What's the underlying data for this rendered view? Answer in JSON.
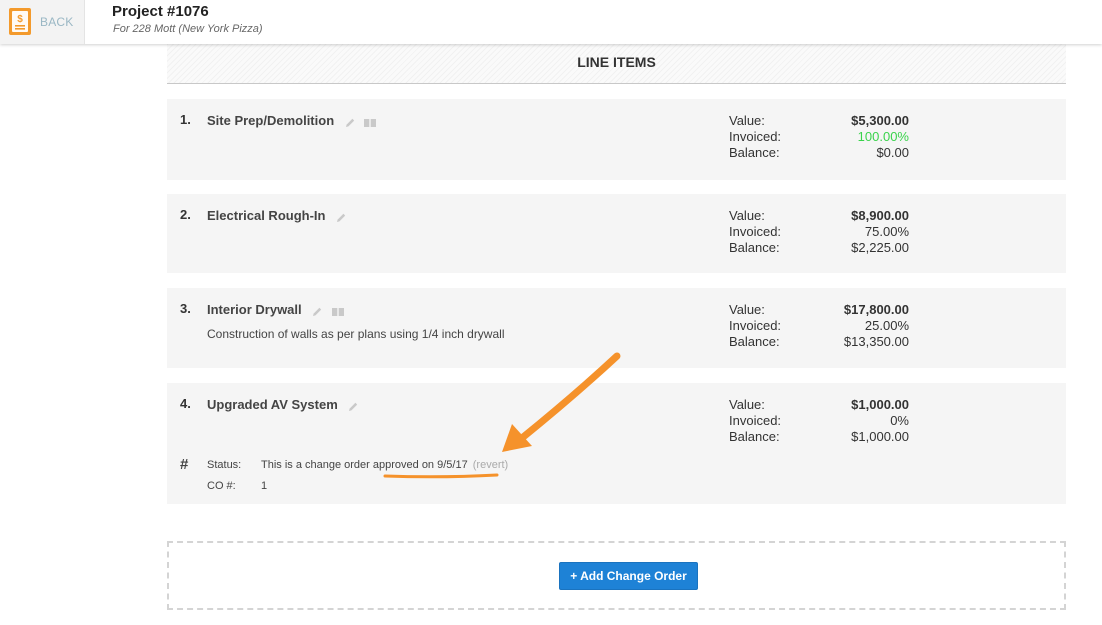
{
  "header": {
    "back_label": "BACK",
    "title": "Project #1076",
    "subtitle": "For 228 Mott (New York Pizza)"
  },
  "section": {
    "title": "LINE ITEMS"
  },
  "labels": {
    "value": "Value:",
    "invoiced": "Invoiced:",
    "balance": "Balance:",
    "status": "Status:",
    "co_num": "CO #:"
  },
  "items": [
    {
      "num": "1.",
      "name": "Site Prep/Demolition",
      "description": "",
      "value": "$5,300.00",
      "invoiced": "100.00%",
      "balance": "$0.00"
    },
    {
      "num": "2.",
      "name": "Electrical Rough-In",
      "description": "",
      "value": "$8,900.00",
      "invoiced": "75.00%",
      "balance": "$2,225.00"
    },
    {
      "num": "3.",
      "name": "Interior Drywall",
      "description": "Construction of walls as per plans using 1/4 inch drywall",
      "value": "$17,800.00",
      "invoiced": "25.00%",
      "balance": "$13,350.00"
    },
    {
      "num": "4.",
      "name": "Upgraded AV System",
      "description": "",
      "value": "$1,000.00",
      "invoiced": "0%",
      "balance": "$1,000.00",
      "change_order": {
        "hash": "#",
        "status_text": "This is a change order approved on 9/5/17",
        "revert_label": "(revert)",
        "co_number": "1"
      }
    }
  ],
  "add_button_label": "+ Add Change Order",
  "colors": {
    "accent": "#1e82d6",
    "invoiced_full": "#3ad34c",
    "annotation": "#f5922b",
    "back_icon": "#f39a2c"
  }
}
